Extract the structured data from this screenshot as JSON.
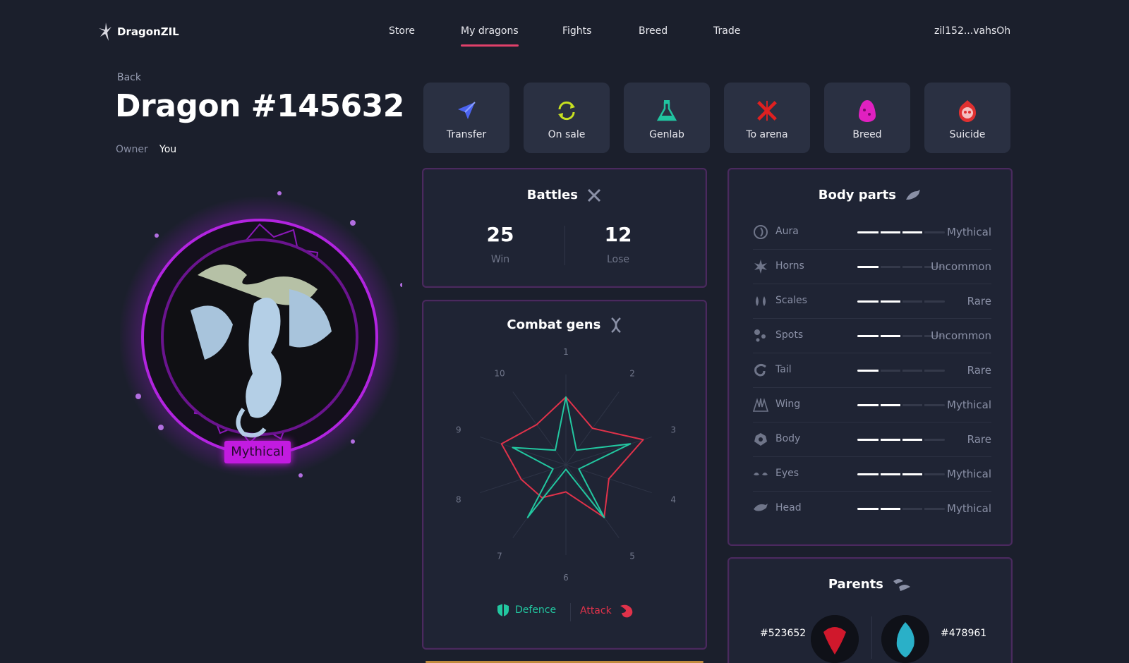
{
  "app": {
    "name": "DragonZIL"
  },
  "nav": {
    "items": [
      {
        "label": "Store",
        "active": false
      },
      {
        "label": "My dragons",
        "active": true
      },
      {
        "label": "Fights",
        "active": false
      },
      {
        "label": "Breed",
        "active": false
      },
      {
        "label": "Trade",
        "active": false
      }
    ],
    "wallet": "zil152...vahsOh"
  },
  "page": {
    "back_label": "Back",
    "title": "Dragon #145632",
    "owner_label": "Owner",
    "owner_value": "You",
    "rarity": "Mythical"
  },
  "actions": [
    {
      "label": "Transfer",
      "icon": "send-icon",
      "color": "#4b63f0"
    },
    {
      "label": "On sale",
      "icon": "refresh-icon",
      "color": "#c8e020"
    },
    {
      "label": "Genlab",
      "icon": "flask-icon",
      "color": "#20c4a0"
    },
    {
      "label": "To arena",
      "icon": "crossed-swords-icon",
      "color": "#e02020"
    },
    {
      "label": "Breed",
      "icon": "egg-icon",
      "color": "#e020c0"
    },
    {
      "label": "Suicide",
      "icon": "skull-flame-icon",
      "color": "#e03030"
    }
  ],
  "battles": {
    "title": "Battles",
    "win": {
      "value": "25",
      "label": "Win"
    },
    "lose": {
      "value": "12",
      "label": "Lose"
    }
  },
  "combat": {
    "title": "Combat gens",
    "axis_labels": [
      "1",
      "2",
      "3",
      "4",
      "5",
      "6",
      "7",
      "8",
      "9",
      "10"
    ],
    "defence_label": "Defence",
    "attack_label": "Attack",
    "defence_color": "#22c7a0",
    "attack_color": "#e0324a"
  },
  "chart_data": {
    "type": "radar",
    "categories": [
      "1",
      "2",
      "3",
      "4",
      "5",
      "6",
      "7",
      "8",
      "9",
      "10"
    ],
    "series": [
      {
        "name": "Attack",
        "values": [
          0.75,
          0.5,
          0.9,
          0.5,
          0.72,
          0.3,
          0.45,
          0.52,
          0.75,
          0.55
        ]
      },
      {
        "name": "Defence",
        "values": [
          0.75,
          0.2,
          0.75,
          0.15,
          0.72,
          0.05,
          0.72,
          0.15,
          0.62,
          0.2
        ]
      }
    ],
    "ylim": [
      0,
      1
    ]
  },
  "body_parts": {
    "title": "Body parts",
    "items": [
      {
        "name": "Aura",
        "rarity": "Mythical",
        "level": 0.75,
        "icon": "aura-icon"
      },
      {
        "name": "Horns",
        "rarity": "Uncommon",
        "level": 0.25,
        "icon": "horns-icon"
      },
      {
        "name": "Scales",
        "rarity": "Rare",
        "level": 0.5,
        "icon": "scales-icon"
      },
      {
        "name": "Spots",
        "rarity": "Uncommon",
        "level": 0.5,
        "icon": "spots-icon"
      },
      {
        "name": "Tail",
        "rarity": "Rare",
        "level": 0.25,
        "icon": "tail-icon"
      },
      {
        "name": "Wing",
        "rarity": "Mythical",
        "level": 0.5,
        "icon": "wing-icon"
      },
      {
        "name": "Body",
        "rarity": "Rare",
        "level": 0.75,
        "icon": "body-icon"
      },
      {
        "name": "Eyes",
        "rarity": "Mythical",
        "level": 0.75,
        "icon": "eyes-icon"
      },
      {
        "name": "Head",
        "rarity": "Mythical",
        "level": 0.5,
        "icon": "head-icon"
      }
    ]
  },
  "parents": {
    "title": "Parents",
    "left_id": "#523652",
    "right_id": "#478961"
  }
}
